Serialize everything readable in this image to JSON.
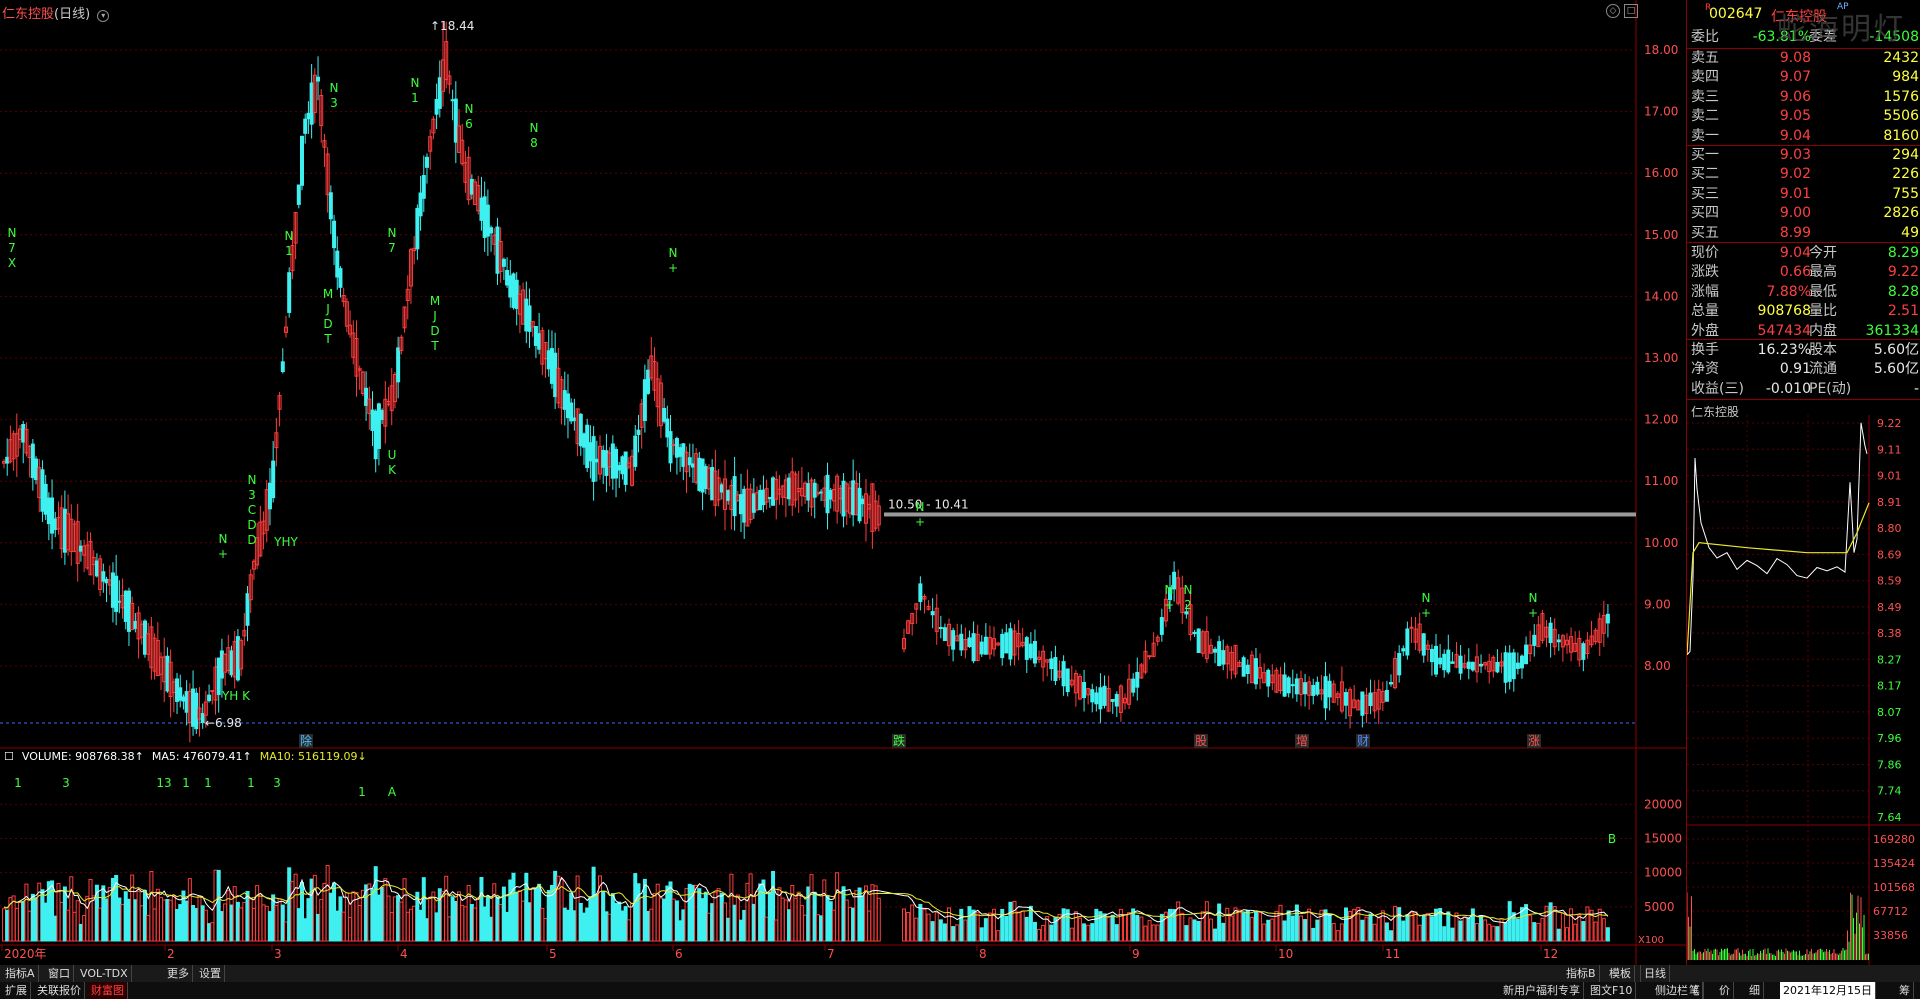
{
  "header": {
    "stock_name": "仁东控股",
    "period": "(日线)"
  },
  "colors": {
    "up": "#ff3c3c",
    "down": "#3ef0f0",
    "grid": "#5a0000",
    "ma5": "#ffffff",
    "ma10": "#e8e82a",
    "signal": "#3cff3c"
  },
  "price_axis": [
    "18.00",
    "17.00",
    "16.00",
    "15.00",
    "14.00",
    "13.00",
    "12.00",
    "11.00",
    "10.00",
    "9.00",
    "8.00"
  ],
  "price_annotations": {
    "high": "18.44",
    "low": "6.98",
    "zone": "10.50 - 10.41"
  },
  "volume_axis": [
    "20000",
    "15000",
    "10000",
    "5000",
    "X100"
  ],
  "volume_legend": {
    "volume": "VOLUME: 908768.38↑",
    "ma5": "MA5: 476079.41↑",
    "ma10": "MA10: 516119.09↓"
  },
  "month_labels": [
    "2020年",
    "2",
    "3",
    "4",
    "5",
    "6",
    "7",
    "8",
    "9",
    "10",
    "11",
    "12"
  ],
  "event_tags": [
    "除",
    "跌",
    "股",
    "增",
    "财",
    "涨"
  ],
  "signals": [
    {
      "text": "N\n7\nX"
    },
    {
      "text": "N\n+"
    },
    {
      "text": "N\n3\nC\nD\nD"
    },
    {
      "text": "YHY"
    },
    {
      "text": "YH K"
    },
    {
      "text": "N\n1"
    },
    {
      "text": "N\n3"
    },
    {
      "text": "M\nJ\nD\nT"
    },
    {
      "text": "N\n7"
    },
    {
      "text": "N\n1"
    },
    {
      "text": "U\nK"
    },
    {
      "text": "M\nJ\nD\nT"
    },
    {
      "text": "N\n6"
    },
    {
      "text": "N\n8"
    },
    {
      "text": "N\n+"
    },
    {
      "text": "N\n+"
    },
    {
      "text": "N\n+"
    },
    {
      "text": "N\n2"
    },
    {
      "text": "N\n+"
    },
    {
      "text": "N\n+"
    }
  ],
  "vol_signals": [
    "1",
    "3",
    "13",
    "1",
    "1",
    "1",
    "3",
    "1",
    "A",
    "B"
  ],
  "quote": {
    "code": "002647",
    "name": "仁东控股",
    "weibi_label": "委比",
    "weibi": "-63.81%",
    "weicha_label": "委差",
    "weicha": "-14508",
    "asks": [
      {
        "label": "卖五",
        "price": "9.08",
        "vol": "2432"
      },
      {
        "label": "卖四",
        "price": "9.07",
        "vol": "984"
      },
      {
        "label": "卖三",
        "price": "9.06",
        "vol": "1576"
      },
      {
        "label": "卖二",
        "price": "9.05",
        "vol": "5506"
      },
      {
        "label": "卖一",
        "price": "9.04",
        "vol": "8160"
      }
    ],
    "bids": [
      {
        "label": "买一",
        "price": "9.03",
        "vol": "294"
      },
      {
        "label": "买二",
        "price": "9.02",
        "vol": "226"
      },
      {
        "label": "买三",
        "price": "9.01",
        "vol": "755"
      },
      {
        "label": "买四",
        "price": "9.00",
        "vol": "2826"
      },
      {
        "label": "买五",
        "price": "8.99",
        "vol": "49"
      }
    ],
    "stats": [
      {
        "l1": "现价",
        "v1": "9.04",
        "c1": "red",
        "l2": "今开",
        "v2": "8.29",
        "c2": "green"
      },
      {
        "l1": "涨跌",
        "v1": "0.66",
        "c1": "red",
        "l2": "最高",
        "v2": "9.22",
        "c2": "red"
      },
      {
        "l1": "涨幅",
        "v1": "7.88%",
        "c1": "red",
        "l2": "最低",
        "v2": "8.28",
        "c2": "green"
      },
      {
        "l1": "总量",
        "v1": "908768",
        "c1": "yellow",
        "l2": "量比",
        "v2": "2.51",
        "c2": "red"
      },
      {
        "l1": "外盘",
        "v1": "547434",
        "c1": "red",
        "l2": "内盘",
        "v2": "361334",
        "c2": "green"
      }
    ],
    "stats2": [
      {
        "l1": "换手",
        "v1": "16.23%",
        "l2": "股本",
        "v2": "5.60亿"
      },
      {
        "l1": "净资",
        "v1": "0.91",
        "l2": "流通",
        "v2": "5.60亿"
      },
      {
        "l1": "收益(三)",
        "v1": "-0.010",
        "l2": "PE(动)",
        "v2": "-"
      }
    ]
  },
  "intraday": {
    "title": "仁东控股",
    "price_axis": [
      "9.22",
      "9.11",
      "9.01",
      "8.91",
      "8.80",
      "8.69",
      "8.59",
      "8.49",
      "8.38",
      "8.27",
      "8.17",
      "8.07",
      "7.96",
      "7.86",
      "7.74",
      "7.64"
    ],
    "vol_axis": [
      "169280",
      "135424",
      "101568",
      "67712",
      "33856"
    ]
  },
  "toolbar1": [
    "指标A",
    "窗口",
    "VOL-TDX",
    "更多",
    "设置"
  ],
  "toolbar1_right": [
    "指标B",
    "模板"
  ],
  "daily_label": "日线",
  "toolbar2": [
    "扩展",
    "关联报价",
    "财富图"
  ],
  "toolbar2_right": [
    "新用户福利专享",
    "图文F10",
    "侧边栏《"
  ],
  "bottom_right": {
    "bi": "笔",
    "jia": "价",
    "xi": "细",
    "date": "2021年12月15日",
    "chou": "筹"
  },
  "watermark": "蛇海明灯"
}
